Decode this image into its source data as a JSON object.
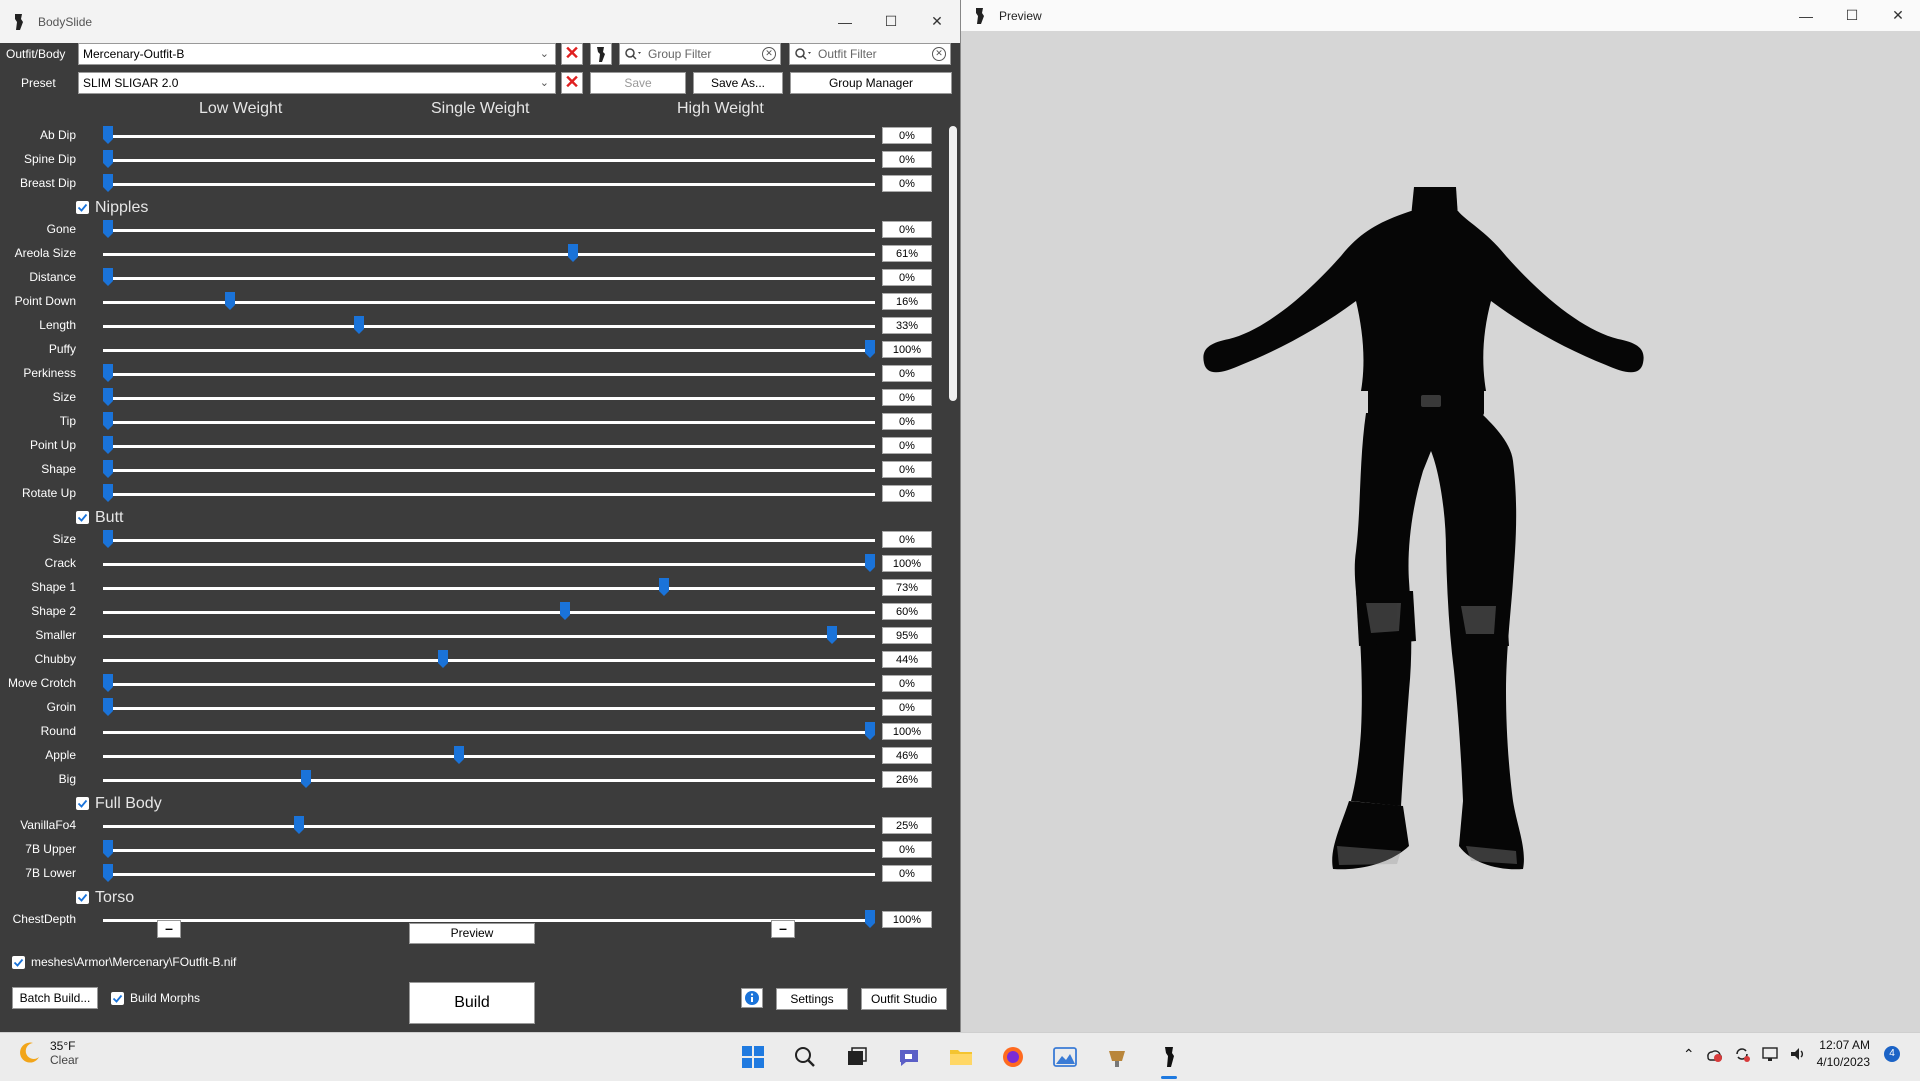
{
  "bodyslide": {
    "title": "BodySlide",
    "outfit_label": "Outfit/Body",
    "outfit_value": "Mercenary-Outfit-B",
    "preset_label": "Preset",
    "preset_value": "SLIM SLIGAR 2.0",
    "group_filter_placeholder": "Group Filter",
    "outfit_filter_placeholder": "Outfit Filter",
    "save_label": "Save",
    "save_as_label": "Save As...",
    "group_manager_label": "Group Manager",
    "col_low": "Low Weight",
    "col_single": "Single Weight",
    "col_high": "High Weight",
    "sections": [
      {
        "group": null,
        "sliders": [
          {
            "name": "Ab Dip",
            "value": 0,
            "display": "0%"
          },
          {
            "name": "Spine Dip",
            "value": 0,
            "display": "0%"
          },
          {
            "name": "Breast Dip",
            "value": 0,
            "display": "0%"
          }
        ]
      },
      {
        "group": "Nipples",
        "sliders": [
          {
            "name": "Gone",
            "value": 0,
            "display": "0%"
          },
          {
            "name": "Areola Size",
            "value": 61,
            "display": "61%"
          },
          {
            "name": "Distance",
            "value": 0,
            "display": "0%"
          },
          {
            "name": "Point Down",
            "value": 16,
            "display": "16%"
          },
          {
            "name": "Length",
            "value": 33,
            "display": "33%"
          },
          {
            "name": "Puffy",
            "value": 100,
            "display": "100%"
          },
          {
            "name": "Perkiness",
            "value": 0,
            "display": "0%"
          },
          {
            "name": "Size",
            "value": 0,
            "display": "0%"
          },
          {
            "name": "Tip",
            "value": 0,
            "display": "0%"
          },
          {
            "name": "Point Up",
            "value": 0,
            "display": "0%"
          },
          {
            "name": "Shape",
            "value": 0,
            "display": "0%"
          },
          {
            "name": "Rotate Up",
            "value": 0,
            "display": "0%"
          }
        ]
      },
      {
        "group": "Butt",
        "sliders": [
          {
            "name": "Size",
            "value": 0,
            "display": "0%"
          },
          {
            "name": "Crack",
            "value": 100,
            "display": "100%"
          },
          {
            "name": "Shape 1",
            "value": 73,
            "display": "73%"
          },
          {
            "name": "Shape 2",
            "value": 60,
            "display": "60%"
          },
          {
            "name": "Smaller",
            "value": 95,
            "display": "95%"
          },
          {
            "name": "Chubby",
            "value": 44,
            "display": "44%"
          },
          {
            "name": "Move Crotch",
            "value": 0,
            "display": "0%"
          },
          {
            "name": "Groin",
            "value": 0,
            "display": "0%"
          },
          {
            "name": "Round",
            "value": 100,
            "display": "100%"
          },
          {
            "name": "Apple",
            "value": 46,
            "display": "46%"
          },
          {
            "name": "Big",
            "value": 26,
            "display": "26%"
          }
        ]
      },
      {
        "group": "Full Body",
        "sliders": [
          {
            "name": "VanillaFo4",
            "value": 25,
            "display": "25%"
          },
          {
            "name": "7B Upper",
            "value": 0,
            "display": "0%"
          },
          {
            "name": "7B Lower",
            "value": 0,
            "display": "0%"
          }
        ]
      },
      {
        "group": "Torso",
        "sliders": [
          {
            "name": "ChestDepth",
            "value": 100,
            "display": "100%"
          }
        ]
      }
    ],
    "preview_label": "Preview",
    "mesh_path": "meshes\\Armor\\Mercenary\\FOutfit-B.nif",
    "batch_build_label": "Batch Build...",
    "build_morphs_label": "Build Morphs",
    "build_label": "Build",
    "settings_label": "Settings",
    "outfit_studio_label": "Outfit Studio",
    "accent_color": "#1a73d9"
  },
  "preview": {
    "title": "Preview"
  },
  "taskbar": {
    "temperature": "35°F",
    "condition": "Clear",
    "time": "12:07 AM",
    "date": "4/10/2023",
    "notification_count": "4"
  }
}
